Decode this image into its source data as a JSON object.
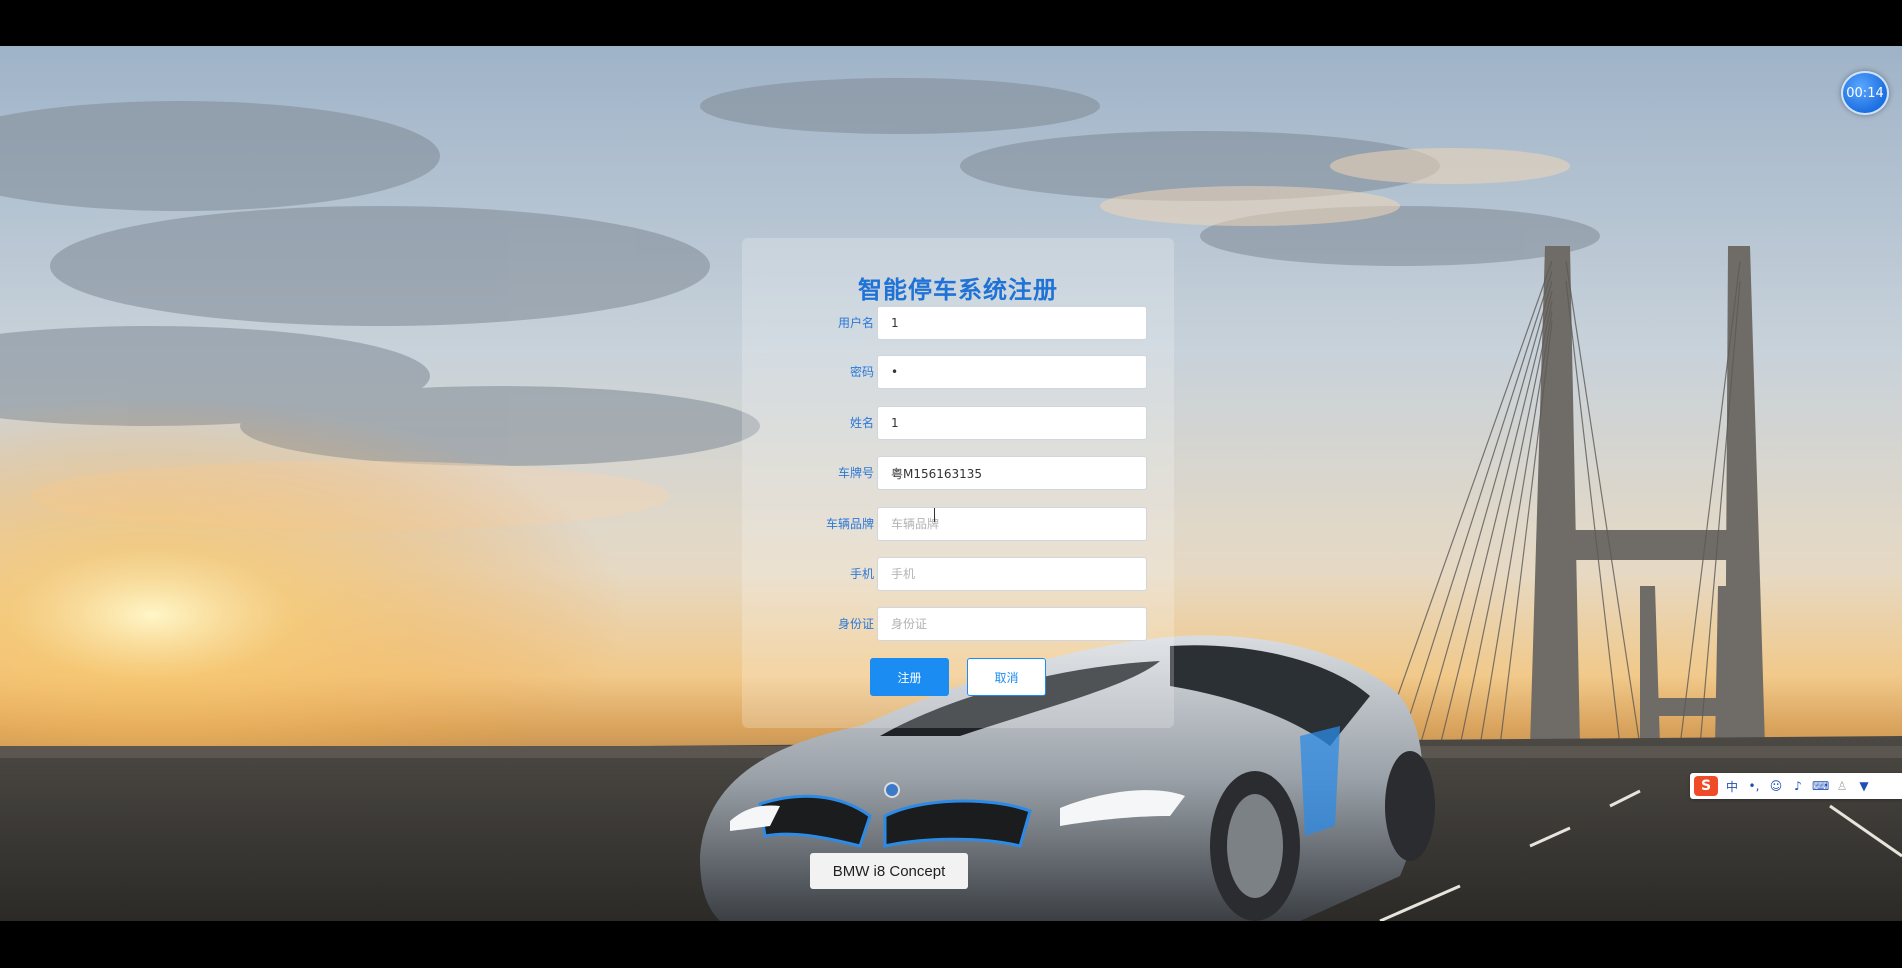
{
  "timer": {
    "text": "00:14"
  },
  "form": {
    "title": "智能停车系统注册",
    "fields": [
      {
        "label": "用户名",
        "value": "1",
        "placeholder": ""
      },
      {
        "label": "密码",
        "value": "•",
        "placeholder": ""
      },
      {
        "label": "姓名",
        "value": "1",
        "placeholder": ""
      },
      {
        "label": "车牌号",
        "value": "粤M156163135",
        "placeholder": ""
      },
      {
        "label": "车辆品牌",
        "value": "",
        "placeholder": "车辆品牌"
      },
      {
        "label": "手机",
        "value": "",
        "placeholder": "手机"
      },
      {
        "label": "身份证",
        "value": "",
        "placeholder": "身份证"
      }
    ],
    "submit_label": "注册",
    "cancel_label": "取消"
  },
  "background": {
    "car_plate": "BMW i8 Concept"
  },
  "ime": {
    "logo": "S",
    "mode": "中",
    "icons": [
      "punctuation-icon",
      "emoji-icon",
      "mic-icon",
      "keyboard-icon",
      "user-icon",
      "skin-icon"
    ]
  },
  "colors": {
    "accent": "#1b8cf2",
    "title": "#1f72d6",
    "label": "#2b78d8"
  }
}
